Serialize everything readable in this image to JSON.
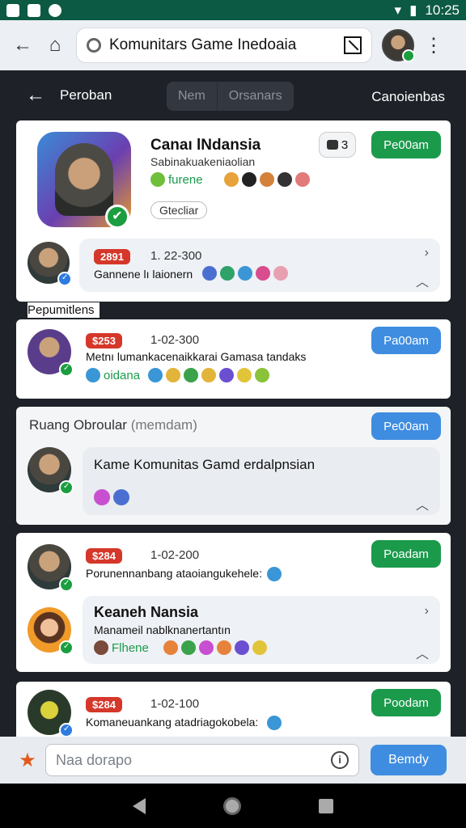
{
  "status": {
    "time": "10:25"
  },
  "browser": {
    "url": "Komunitars Game Inedoaia"
  },
  "header": {
    "back_label": "Peroban",
    "seg_1": "Nem",
    "seg_2": "Orsanars",
    "right_label": "Canoienbas"
  },
  "profile_card": {
    "name": "Canaı lNdansia",
    "subtitle": "Sabinakuakeniaolian",
    "emoji_label": "furene",
    "count": "3",
    "action": "Pe00am",
    "tag_chip": "Gtecliar",
    "post_tag": "2891",
    "post_date": "1. 22-300",
    "post_text": "Gannene lı laionern"
  },
  "section_label": "Pepumitlens",
  "card2": {
    "tag": "$253",
    "date": "1-02-300",
    "text": "Metnı lumankacenaikkarai Gamasa tandaks",
    "emoji_label": "oidana",
    "action": "Pa00am"
  },
  "card3": {
    "title": "Ruang Obroular",
    "title_muted": "(memdam)",
    "action": "Pe00am",
    "bubble": "Kame Komunitas Gamd erdalpnsian"
  },
  "card4": {
    "tag": "$284",
    "date": "1-02-200",
    "text": "Porunennanbang ataoiangukehele:",
    "action": "Poadam",
    "sub_name": "Keaneh Nansia",
    "sub_text": "Manameil nablknanertantın",
    "sub_emoji_label": "Flhene"
  },
  "card5": {
    "tag": "$284",
    "date": "1-02-100",
    "text": "Komaneuankang atadriagokobela:",
    "action": "Poodam"
  },
  "composer": {
    "placeholder": "Naa dorapo",
    "send": "Bemdy"
  }
}
